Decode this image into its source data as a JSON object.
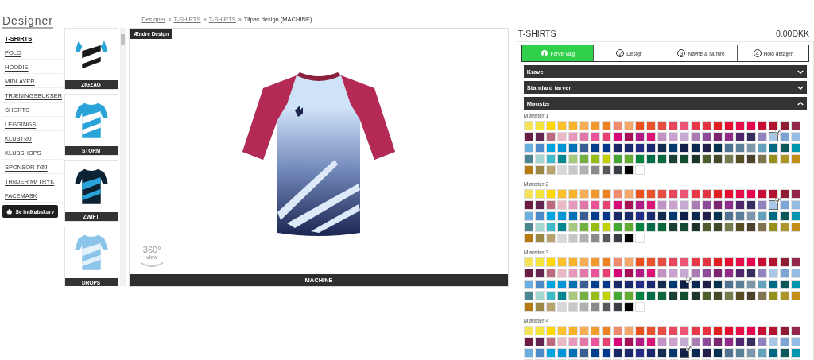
{
  "sidebar": {
    "title": "Designer",
    "items": [
      {
        "label": "T-SHIRTS",
        "selected": true
      },
      {
        "label": "POLO",
        "selected": false
      },
      {
        "label": "HOODIE",
        "selected": false
      },
      {
        "label": "MIDLAYER",
        "selected": false
      },
      {
        "label": "TRÆNINGSBUKSER",
        "selected": false
      },
      {
        "label": "SHORTS",
        "selected": false
      },
      {
        "label": "LEGGINGS",
        "selected": false
      },
      {
        "label": "KLUBTØJ",
        "selected": false
      },
      {
        "label": "KLUBSHOPS",
        "selected": false
      },
      {
        "label": "SPONSOR TØJ",
        "selected": false
      },
      {
        "label": "TRØJER M/ TRYK",
        "selected": false
      },
      {
        "label": "FACEMASK",
        "selected": false
      }
    ],
    "cart_button": "Se indkøbskurv"
  },
  "designs": [
    {
      "name": "ZIGZAG",
      "kind": "zigzag"
    },
    {
      "name": "STORM",
      "kind": "storm"
    },
    {
      "name": "ZWIFT",
      "kind": "zwift"
    },
    {
      "name": "DROPS",
      "kind": "drops"
    }
  ],
  "breadcrumb": {
    "links": [
      "Designer",
      "T-SHIRTS",
      "T-SHIRTS"
    ],
    "separator": "»",
    "current": "Tilpas design (MACHINE)"
  },
  "viewer": {
    "change_button": "Ændre Design",
    "view_360": "360°",
    "view_label": "view",
    "caption": "MACHINE"
  },
  "panel": {
    "title": "T-SHIRTS",
    "price": "0.00DKK",
    "steps": [
      {
        "number": "1",
        "label": "Farve Valg",
        "selected": true
      },
      {
        "number": "2",
        "label": "Design",
        "selected": false
      },
      {
        "number": "3",
        "label": "Navne & Numre",
        "selected": false
      },
      {
        "number": "4",
        "label": "Hold detaljer",
        "selected": false
      }
    ],
    "sections": [
      {
        "label": "Krave",
        "expanded": false
      },
      {
        "label": "Standard farver",
        "expanded": false
      },
      {
        "label": "Mønster",
        "expanded": true
      }
    ],
    "patterns": [
      {
        "label": "Mønster 1",
        "selected_swatch": {
          "color": "#abc7e6"
        }
      },
      {
        "label": "Mønster 2",
        "selected_swatch": {
          "color": "#abc7e6"
        }
      },
      {
        "label": "Mønster 3",
        "selected_swatch": {
          "color": "#12204a"
        }
      },
      {
        "label": "Mønster 4",
        "selected_swatch": {
          "color": "#12204a"
        }
      }
    ],
    "palette": [
      {
        "color": "#f3e45a"
      },
      {
        "color": "#f3e53c"
      },
      {
        "color": "#fdd900"
      },
      {
        "color": "#fcc12d"
      },
      {
        "color": "#f9b32b"
      },
      {
        "color": "#f6ad55"
      },
      {
        "color": "#f49a2c"
      },
      {
        "color": "#f08120"
      },
      {
        "color": "#f18b6f"
      },
      {
        "color": "#f4a66a"
      },
      {
        "color": "#e8501c"
      },
      {
        "color": "#e8522d"
      },
      {
        "color": "#e64e43"
      },
      {
        "color": "#e6475c"
      },
      {
        "color": "#e85575"
      },
      {
        "color": "#e63849"
      },
      {
        "color": "#e53541"
      },
      {
        "color": "#e1201f"
      },
      {
        "color": "#e30d32"
      },
      {
        "color": "#e50e49"
      },
      {
        "color": "#e3064f"
      },
      {
        "color": "#c70c34"
      },
      {
        "color": "#b01431"
      },
      {
        "color": "#8e1d33"
      },
      {
        "color": "#922749"
      },
      {
        "color": "#6b1c42"
      },
      {
        "color": "#642650"
      },
      {
        "color": "#bd6a7f"
      },
      {
        "color": "#e9b9c5"
      },
      {
        "color": "#e798bd"
      },
      {
        "color": "#e477aa"
      },
      {
        "color": "#e9539a"
      },
      {
        "color": "#e64171"
      },
      {
        "color": "#d50778"
      },
      {
        "color": "#a70f56"
      },
      {
        "color": "#b11b85"
      },
      {
        "color": "#d81675"
      },
      {
        "color": "#c095c3"
      },
      {
        "color": "#caa0cc"
      },
      {
        "color": "#c4a9d0"
      },
      {
        "color": "#a97db3"
      },
      {
        "color": "#8d4a98"
      },
      {
        "color": "#7b2671"
      },
      {
        "color": "#902b8b"
      },
      {
        "color": "#50276e"
      },
      {
        "color": "#372e5f"
      },
      {
        "color": "#9181bc"
      },
      {
        "color": "#abc7e6"
      },
      {
        "color": "#7ea4d6"
      },
      {
        "color": "#95bce3"
      },
      {
        "color": "#6aaee0"
      },
      {
        "color": "#4b8bca"
      },
      {
        "color": "#00a4de"
      },
      {
        "color": "#0095d4"
      },
      {
        "color": "#0070b7"
      },
      {
        "color": "#3b5f94"
      },
      {
        "color": "#033f8c"
      },
      {
        "color": "#05388c"
      },
      {
        "color": "#1a2866"
      },
      {
        "color": "#19296a"
      },
      {
        "color": "#232b84"
      },
      {
        "color": "#1a2970"
      },
      {
        "color": "#142c4f"
      },
      {
        "color": "#053a70"
      },
      {
        "color": "#12204a"
      },
      {
        "color": "#0a2a50"
      },
      {
        "color": "#22204b"
      },
      {
        "color": "#04324f"
      },
      {
        "color": "#4f7290"
      },
      {
        "color": "#5b7f99"
      },
      {
        "color": "#7c97aa"
      },
      {
        "color": "#63a1bc"
      },
      {
        "color": "#006a84"
      },
      {
        "color": "#0b5759"
      },
      {
        "color": "#0096ad"
      },
      {
        "color": "#4b858f"
      },
      {
        "color": "#a5d7d2"
      },
      {
        "color": "#3ebac8"
      },
      {
        "color": "#008790"
      },
      {
        "color": "#a6c87f"
      },
      {
        "color": "#70b140"
      },
      {
        "color": "#95be14"
      },
      {
        "color": "#c4d100"
      },
      {
        "color": "#44a634"
      },
      {
        "color": "#63ab2e"
      },
      {
        "color": "#00833e"
      },
      {
        "color": "#006b48"
      },
      {
        "color": "#09693a"
      },
      {
        "color": "#1d4036"
      },
      {
        "color": "#134c33"
      },
      {
        "color": "#1b3328"
      },
      {
        "color": "#4d5d2e"
      },
      {
        "color": "#404a29"
      },
      {
        "color": "#737c4c"
      },
      {
        "color": "#574d25"
      },
      {
        "color": "#4c412d"
      },
      {
        "color": "#7f7350"
      },
      {
        "color": "#95901b"
      },
      {
        "color": "#ad9527"
      },
      {
        "color": "#c18f1a"
      },
      {
        "color": "#b47b14"
      },
      {
        "color": "#9d8747"
      },
      {
        "color": "#b8a36e"
      },
      {
        "color": "#d7d8da"
      },
      {
        "color": "#c6c7c9"
      },
      {
        "color": "#b1b1b1"
      },
      {
        "color": "#8a8a8a"
      },
      {
        "color": "#58585a"
      },
      {
        "color": "#373e46"
      },
      {
        "color": "#000000"
      },
      {
        "color": "#ffffff"
      }
    ]
  }
}
